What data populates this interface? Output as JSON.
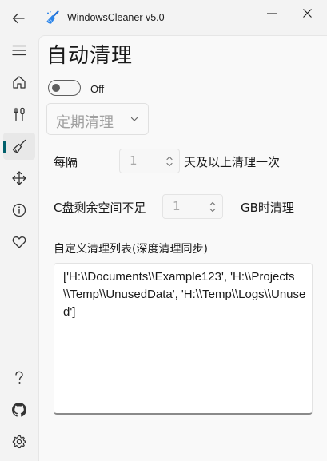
{
  "window": {
    "title": "WindowsCleaner v5.0",
    "icons": {
      "back": "arrow-left-icon",
      "minimize": "minimize-icon",
      "close": "close-icon",
      "app": "broom-app-icon"
    }
  },
  "nav": {
    "items": [
      {
        "name": "menu-icon"
      },
      {
        "name": "home-icon"
      },
      {
        "name": "tools-icon"
      },
      {
        "name": "broom-icon",
        "selected": true
      },
      {
        "name": "move-arrows-icon"
      },
      {
        "name": "info-icon"
      },
      {
        "name": "heart-icon"
      },
      {
        "name": "help-icon"
      },
      {
        "name": "github-icon"
      },
      {
        "name": "settings-gear-icon"
      }
    ],
    "accent": "#005f6b"
  },
  "page": {
    "title": "自动清理",
    "toggle": {
      "state": "Off",
      "on": false
    },
    "mode": {
      "selected": "定期清理"
    },
    "interval": {
      "prefix": "每隔",
      "value": "1",
      "suffix": "天及以上清理一次"
    },
    "space": {
      "prefix": "C盘剩余空间不足",
      "value": "1",
      "suffix": "GB时清理"
    },
    "list": {
      "label": "自定义清理列表(深度清理同步)",
      "value": "['H:\\\\Documents\\\\Example123', 'H:\\\\Projects\\\\Temp\\\\UnusedData', 'H:\\\\Temp\\\\Logs\\\\Unused']"
    }
  }
}
